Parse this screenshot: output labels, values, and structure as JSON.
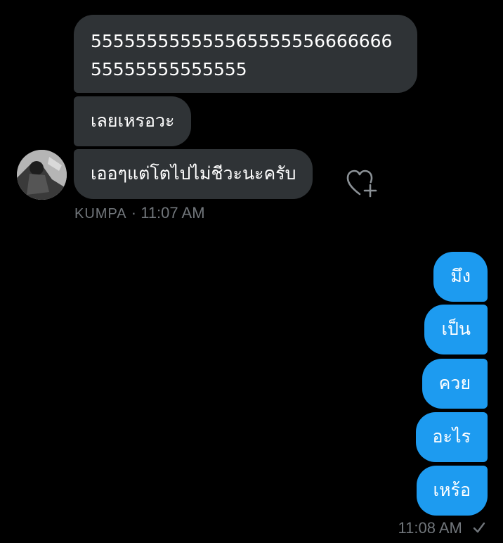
{
  "conversation": {
    "incoming": {
      "sender": "KUMPA",
      "timestamp": "11:07 AM",
      "messages": [
        {
          "text": "55555555555556555555666666655555555555555"
        },
        {
          "text": "เลยเหรอวะ"
        },
        {
          "text": "เออๆแต่โตไปไม่ชีวะนะครับ"
        }
      ]
    },
    "outgoing": {
      "timestamp": "11:08 AM",
      "status_icon": "checkmark-icon",
      "messages": [
        {
          "text": "มึง"
        },
        {
          "text": "เป็น"
        },
        {
          "text": "ควย"
        },
        {
          "text": "อะไร"
        },
        {
          "text": "เหร้อ"
        }
      ]
    },
    "icons": {
      "react": "heart-plus-icon",
      "avatar": "avatar"
    },
    "colors": {
      "background": "#000000",
      "incoming_bubble": "#2f3336",
      "outgoing_bubble": "#1d9bf0",
      "meta_text": "#71767b"
    }
  }
}
